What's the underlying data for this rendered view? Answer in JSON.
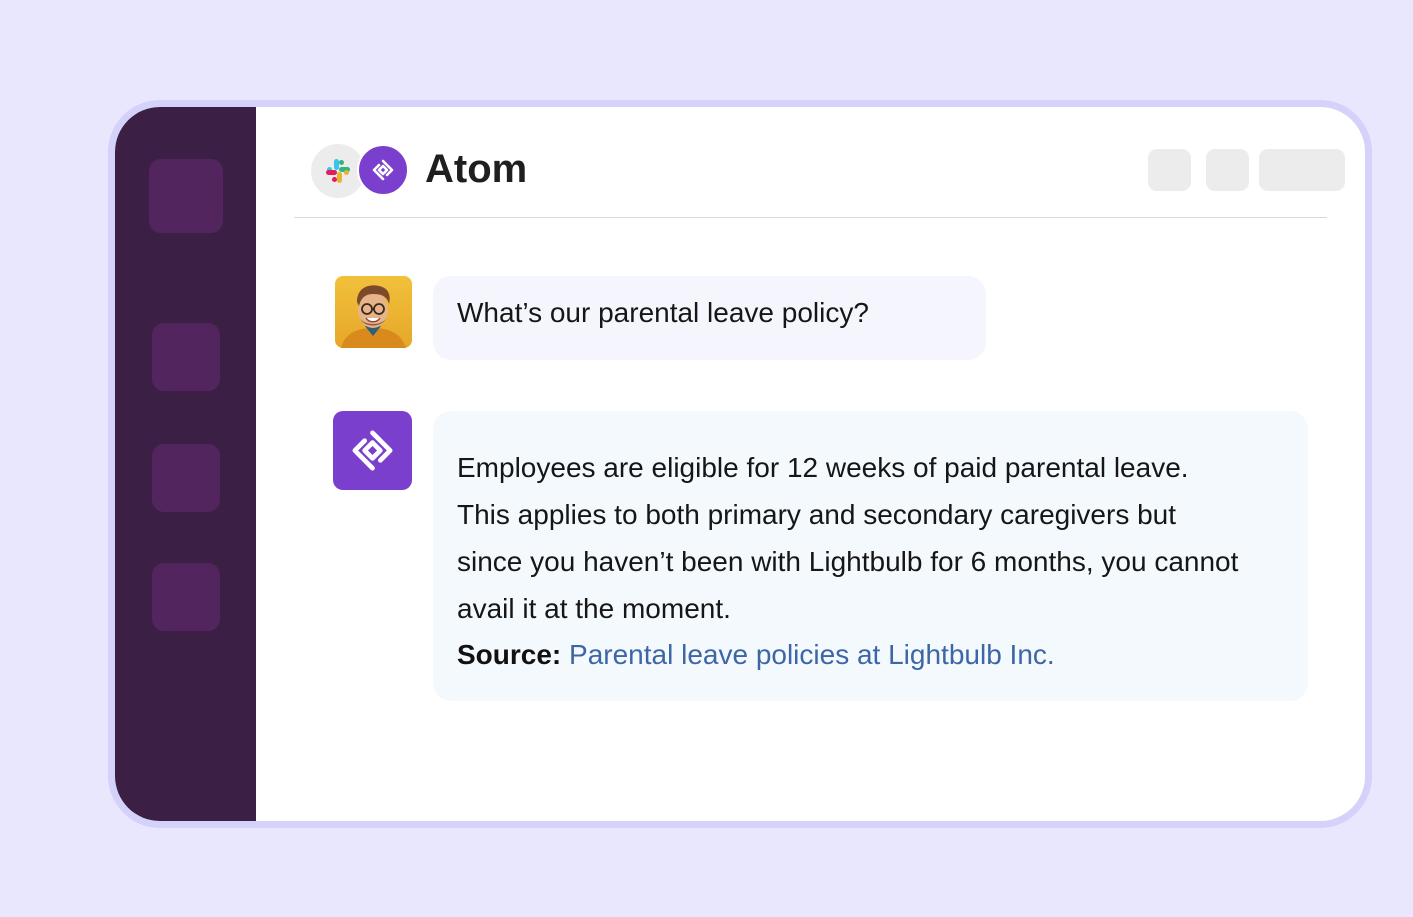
{
  "app": {
    "title": "Atom"
  },
  "colors": {
    "background": "#e9e7fd",
    "window_border": "#d4d2fb",
    "sidebar": "#3c1f44",
    "sidebar_tile": "#52255f",
    "brand_purple": "#7b3fcd",
    "link": "#3c66a6"
  },
  "icons": {
    "integration": "slack-icon",
    "app_badge": "atom-logo-icon",
    "bot_avatar": "atom-logo-icon",
    "user_avatar": "user-avatar-photo"
  },
  "conversation": {
    "user_message": "What’s our parental leave policy?",
    "bot_message": "Employees are eligible for 12 weeks of paid parental leave. This applies to both primary and secondary caregivers but since you haven’t been with Lightbulb for 6 months, you cannot avail it at the moment.",
    "source_label": "Source:",
    "source_link": "Parental leave policies at Lightbulb Inc."
  }
}
